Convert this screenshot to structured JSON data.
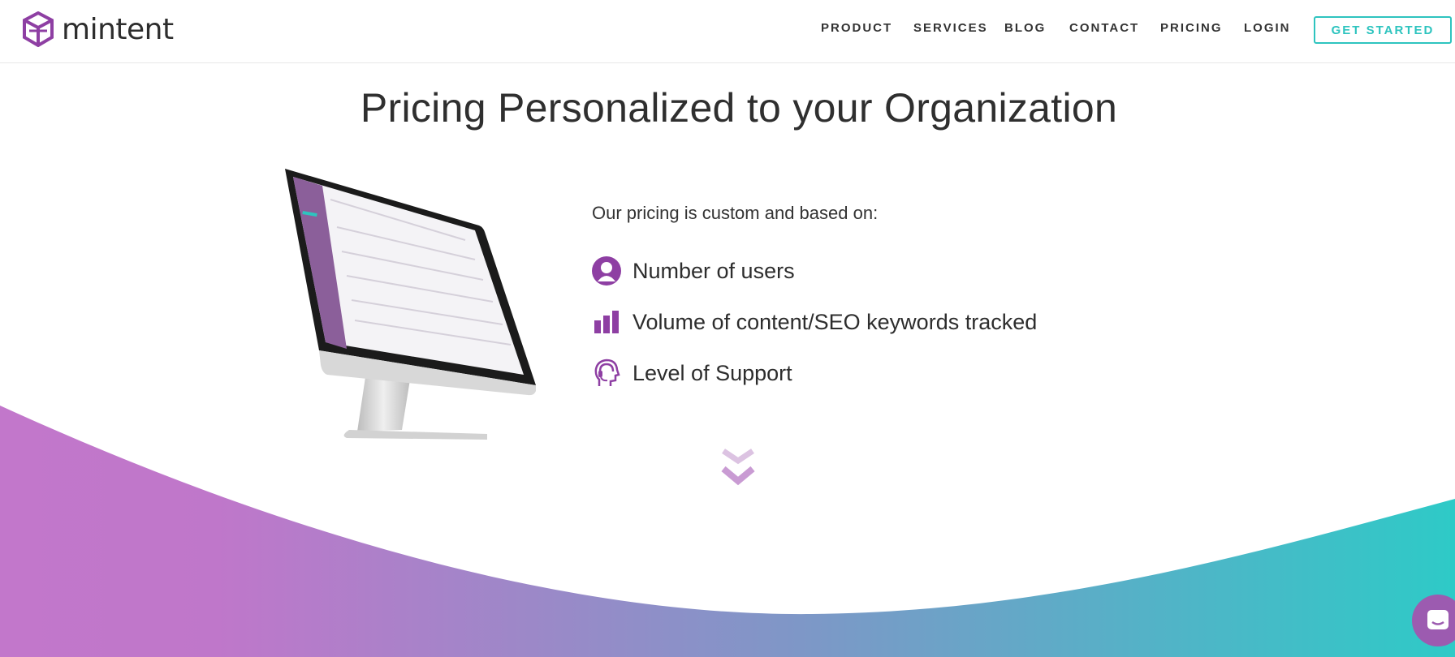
{
  "header": {
    "logo_text": "mintent",
    "nav": [
      "PRODUCT",
      "SERVICES",
      "BLOG",
      "CONTACT",
      "PRICING",
      "LOGIN"
    ],
    "cta": "GET STARTED"
  },
  "main": {
    "title": "Pricing Personalized to your Organization",
    "intro": "Our pricing is custom and based on:",
    "features": [
      {
        "icon": "user-circle-icon",
        "label": "Number of users"
      },
      {
        "icon": "bar-chart-icon",
        "label": "Volume of content/SEO keywords tracked"
      },
      {
        "icon": "support-headset-icon",
        "label": "Level of Support"
      }
    ]
  },
  "colors": {
    "brand_purple": "#8e3fa3",
    "accent_teal": "#2ec4bf",
    "wave_start": "#c277cb",
    "wave_end": "#2ecac7"
  }
}
